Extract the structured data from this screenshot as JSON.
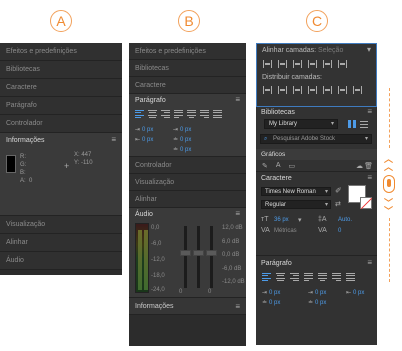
{
  "badges": {
    "a": "A",
    "b": "B",
    "c": "C"
  },
  "panelA": {
    "rows_top": [
      "Efeitos e predefinições",
      "Bibliotecas",
      "Caractere",
      "Parágrafo",
      "Controlador"
    ],
    "info": {
      "title": "Informações",
      "r": "R:",
      "g": "G:",
      "b": "B:",
      "a": "A:",
      "a_val": "0",
      "x": "X:",
      "x_val": "447",
      "y": "Y:",
      "y_val": "-110"
    },
    "rows_bottom": [
      "Visualização",
      "Alinhar",
      "Áudio"
    ]
  },
  "panelB": {
    "rows_top": [
      "Efeitos e predefinições",
      "Bibliotecas",
      "Caractere"
    ],
    "paragraph": {
      "title": "Parágrafo",
      "ind1": "0 px",
      "ind2": "0 px",
      "ind3": "0 px",
      "ind4": "0 px",
      "ind5": "0 px"
    },
    "rows_mid": [
      "Controlador",
      "Visualização",
      "Alinhar"
    ],
    "audio": {
      "title": "Áudio",
      "left_db": [
        "0,0",
        "-6,0",
        "-12,0",
        "-18,0",
        "-24,0"
      ],
      "right_db": [
        "12,0 dB",
        "6,0 dB",
        "0,0 dB",
        "-6,0 dB",
        "-12,0 dB"
      ],
      "fader_vals": [
        "0",
        "0",
        "0"
      ]
    },
    "info_row": "Informações"
  },
  "panelC": {
    "align": {
      "title": "Alinhar camadas:",
      "selection": "Seleção",
      "distribute": "Distribuir camadas:"
    },
    "libraries": {
      "title": "Bibliotecas",
      "selected": "My Library",
      "search_placeholder": "Pesquisar Adobe Stock",
      "graphics": "Gráficos"
    },
    "character": {
      "title": "Caractere",
      "font": "Times New Roman",
      "style": "Regular",
      "size": "36 px",
      "leading": "Auto.",
      "kerning": "Métricas",
      "tracking": "0"
    },
    "paragraph": {
      "title": "Parágrafo",
      "v1": "0 px",
      "v2": "0 px",
      "v3": "0 px",
      "v4": "0 px",
      "v5": "0 px"
    }
  },
  "colors": {
    "accent_orange": "#f08a30",
    "accent_blue": "#4d9be8",
    "panel_bg": "#323232"
  }
}
